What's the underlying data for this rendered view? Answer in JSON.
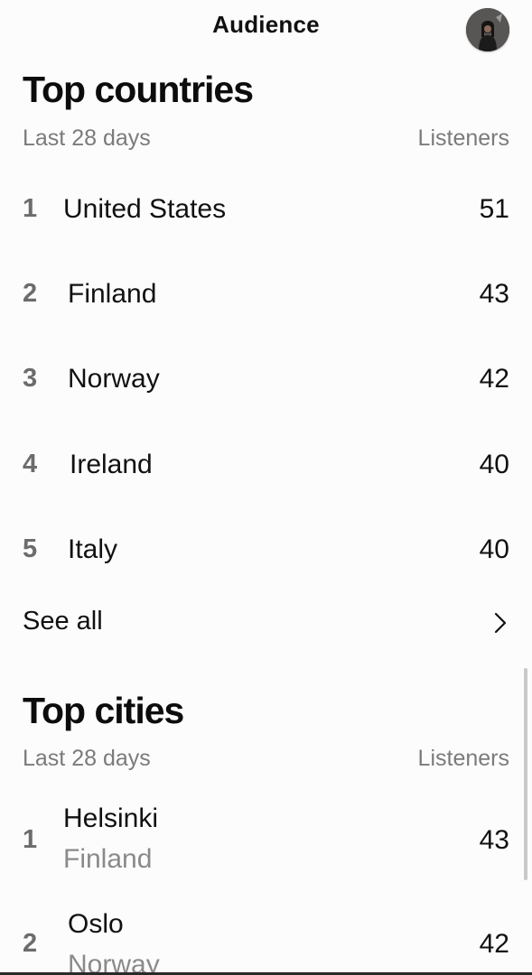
{
  "header": {
    "title": "Audience"
  },
  "top_countries": {
    "title": "Top countries",
    "period": "Last 28 days",
    "metric": "Listeners",
    "rows": [
      {
        "rank": "1",
        "name": "United States",
        "value": "51"
      },
      {
        "rank": "2",
        "name": "Finland",
        "value": "43"
      },
      {
        "rank": "3",
        "name": "Norway",
        "value": "42"
      },
      {
        "rank": "4",
        "name": "Ireland",
        "value": "40"
      },
      {
        "rank": "5",
        "name": "Italy",
        "value": "40"
      }
    ],
    "see_all": "See all"
  },
  "top_cities": {
    "title": "Top cities",
    "period": "Last 28 days",
    "metric": "Listeners",
    "rows": [
      {
        "rank": "1",
        "city": "Helsinki",
        "country": "Finland",
        "value": "43"
      },
      {
        "rank": "2",
        "city": "Oslo",
        "country": "Norway",
        "value": "42"
      }
    ]
  },
  "icons": {
    "avatar": "profile-avatar",
    "see_all": "chevron-right-icon"
  }
}
